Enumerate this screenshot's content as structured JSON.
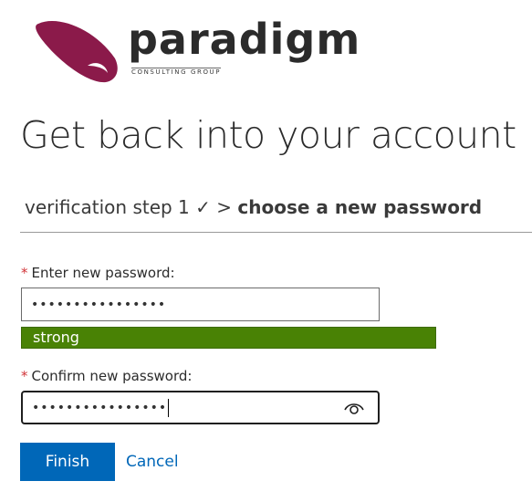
{
  "brand": {
    "name": "paradigm",
    "tagline": "CONSULTING GROUP",
    "accent_color": "#8b1a4a"
  },
  "page": {
    "title": "Get back into your account"
  },
  "steps": {
    "completed": "verification step 1 ✓",
    "separator": ">",
    "current": "choose a new password"
  },
  "new_password": {
    "required_mark": "*",
    "label": "Enter new password:",
    "value": "••••••••••••••••",
    "strength_label": "strong",
    "strength_color": "#498205"
  },
  "confirm_password": {
    "required_mark": "*",
    "label": "Confirm new password:",
    "value": "••••••••••••••••",
    "reveal_icon": "eye-icon"
  },
  "actions": {
    "finish_label": "Finish",
    "cancel_label": "Cancel",
    "primary_color": "#0067b8"
  }
}
